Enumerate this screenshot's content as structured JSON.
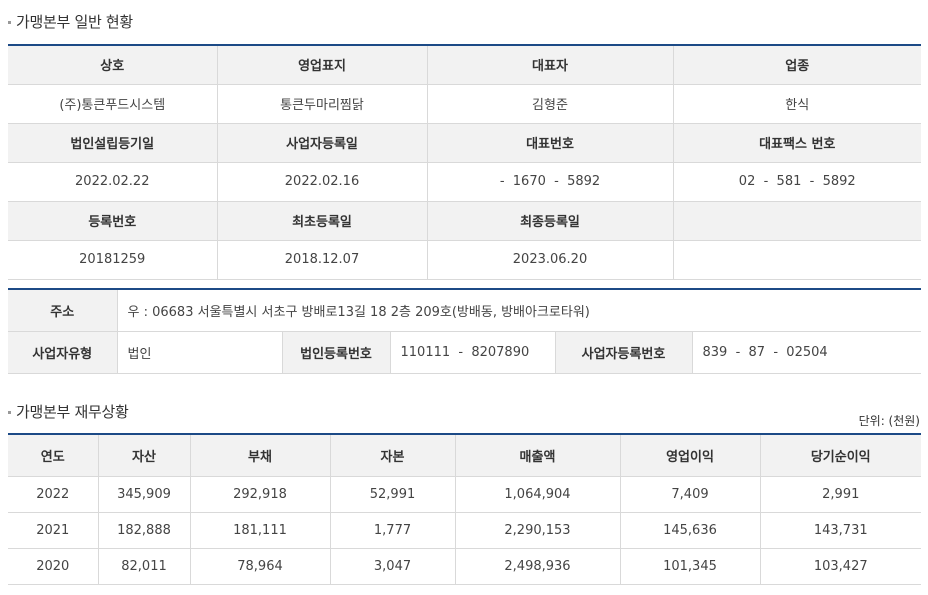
{
  "section1": {
    "title": "가맹본부 일반 현황"
  },
  "general": {
    "row1_headers": [
      "상호",
      "영업표지",
      "대표자",
      "업종"
    ],
    "row1_values": [
      "(주)통큰푸드시스템",
      "통큰두마리찜닭",
      "김형준",
      "한식"
    ],
    "row2_headers": [
      "법인설립등기일",
      "사업자등록일",
      "대표번호",
      "대표팩스 번호"
    ],
    "row2_values": [
      "2022.02.22",
      "2022.02.16",
      "-  1670  -  5892",
      "02  -  581  -  5892"
    ],
    "row3_headers": [
      "등록번호",
      "최초등록일",
      "최종등록일",
      ""
    ],
    "row3_values": [
      "20181259",
      "2018.12.07",
      "2023.06.20",
      ""
    ]
  },
  "address": {
    "label": "주소",
    "value": "우 : 06683 서울특별시 서초구 방배로13길 18 2층 209호(방배동, 방배아크로타워)",
    "biz_type_label": "사업자유형",
    "biz_type_value": "법인",
    "corp_no_label": "법인등록번호",
    "corp_no_value": "110111  -  8207890",
    "biz_no_label": "사업자등록번호",
    "biz_no_value": "839  -  87  -  02504"
  },
  "section2": {
    "title": "가맹본부 재무상황",
    "unit": "단위: (천원)"
  },
  "finance": {
    "headers": [
      "연도",
      "자산",
      "부채",
      "자본",
      "매출액",
      "영업이익",
      "당기순이익"
    ],
    "rows": [
      [
        "2022",
        "345,909",
        "292,918",
        "52,991",
        "1,064,904",
        "7,409",
        "2,991"
      ],
      [
        "2021",
        "182,888",
        "181,111",
        "1,777",
        "2,290,153",
        "145,636",
        "143,731"
      ],
      [
        "2020",
        "82,011",
        "78,964",
        "3,047",
        "2,498,936",
        "101,345",
        "103,427"
      ]
    ]
  }
}
